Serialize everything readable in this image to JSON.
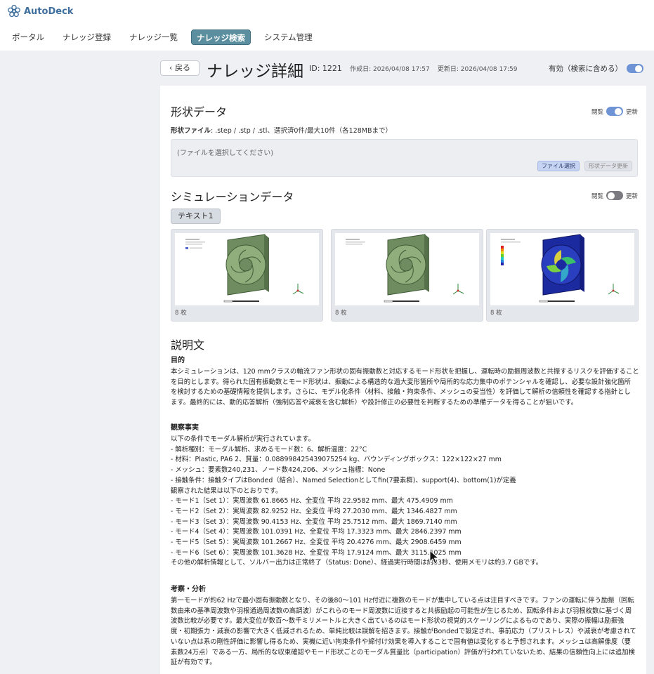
{
  "app": {
    "name": "AutoDeck",
    "logo_icon": "flower-logo-icon",
    "accent": "#3f6f9e"
  },
  "nav": [
    {
      "label": "ポータル",
      "active": false
    },
    {
      "label": "ナレッジ登録",
      "active": false
    },
    {
      "label": "ナレッジ一覧",
      "active": false
    },
    {
      "label": "ナレッジ検索",
      "active": true
    },
    {
      "label": "システム管理",
      "active": false
    }
  ],
  "header": {
    "back_label": "戻る",
    "title": "ナレッジ詳細",
    "id": "ID: 1221",
    "created": "作成日: 2026/04/08 17:57",
    "updated": "更新日: 2026/04/08 17:59",
    "active_label": "有効（検索に含める）",
    "active_on": true
  },
  "shape": {
    "title": "形状データ",
    "view_label": "閲覧",
    "edit_label": "更新",
    "toggle_on": true,
    "hint_label": "形状ファイル",
    "hint_text": ": .step / .stp / .stl、選択済0件/最大10件（各128MBまで）",
    "placeholder": "(ファイルを選択してください)",
    "select_button": "ファイル選択",
    "update_button": "形状データ更新"
  },
  "simulation": {
    "title": "シミュレーションデータ",
    "view_label": "閲覧",
    "edit_label": "更新",
    "toggle_on": false,
    "tab_label": "テキスト1",
    "thumbnails": [
      {
        "count": "8 枚",
        "variant": "total-deformation-green"
      },
      {
        "count": "8 枚",
        "variant": "mode-shape-green"
      },
      {
        "count": "8 枚",
        "variant": "contour-colored"
      }
    ]
  },
  "description": {
    "title": "説明文",
    "purpose": {
      "heading": "目的",
      "lines": [
        "本シミュレーションは、120 mmクラスの軸流ファン形状の固有振動数と対応するモード形状を把握し、運転時の励振周波数と共振するリスクを評価すること",
        "を目的とします。得られた固有振動数とモード形状は、振動による構造的な過大変形箇所や局所的な応力集中のポテンシャルを確認し、必要な設計強化箇所",
        "を検討するための基礎情報を提供します。さらに、モデル化条件（材料、接触・拘束条件、メッシュの妥当性）を評価して解析の信頼性を確認する指針とし",
        "ます。最終的には、動的応答解析（強制応答や減衰を含む解析）や設計修正の必要性を判断するための準備データを得ることが狙いです。"
      ]
    },
    "observation": {
      "heading": "観察事実",
      "lines": [
        "以下の条件でモーダル解析が実行されています。",
        "- 解析種別：モーダル解析、求めるモード数：6、解析温度：22°C",
        "- 材料：Plastic, PA6 2、質量：0.088998425439075254 kg、バウンディングボックス：122×122×27 mm",
        "- メッシュ：要素数240,231、ノード数424,206、メッシュ指標：None",
        "- 接触条件：接触タイプはBonded（結合）、Named Selectionとしてfin(7要素群)、support(4)、bottom(1)が定義",
        "観察された結果は以下のとおりです。",
        "- モード1（Set 1）：実周波数 61.8665 Hz、全変位 平均 22.9582 mm、最大 475.4909 mm",
        "- モード2（Set 2）：実周波数 82.9252 Hz、全変位 平均 27.2030 mm、最大 1346.4827 mm",
        "- モード3（Set 3）：実周波数 90.4153 Hz、全変位 平均 25.7512 mm、最大 1869.7140 mm",
        "- モード4（Set 4）：実周波数 101.0391 Hz、全変位 平均 17.3323 mm、最大 2846.2397 mm",
        "- モード5（Set 5）：実周波数 101.2667 Hz、全変位 平均 20.4276 mm、最大 2908.6459 mm",
        "- モード6（Set 6）：実周波数 101.3628 Hz、全変位 平均 17.9124 mm、最大 3115.5025 mm",
        "その他の解析情報として、ソルバー出力は正常終了（Status: Done）、経過実行時間は約83秒、使用メモリは約3.7 GBです。"
      ]
    },
    "analysis": {
      "heading": "考察・分析",
      "lines": [
        "第一モードが約62 Hzで最小固有振動数となり、その後80〜101 Hz付近に複数のモードが集中している点は注目すべきです。ファンの運転に伴う励振（回転",
        "数由来の基準周波数や羽根通過周波数の高調波）がこれらのモード周波数に近接すると共振励起の可能性が生じるため、回転条件および羽根枚数に基づく周",
        "波数比較が必要です。最大変位が数百〜数千ミリメートルと大きく出ているのはモード形状の視覚的スケーリングによるものであり、実際の振幅は励振強",
        "度・初期張力・減衰の影響で大きく低減されるため、単純比較は誤解を招きます。接触がBondedで設定され、事前応力（プリストレス）や減衰が考慮されて",
        "いない点は系の剛性評価に影響し得るため、実機に近い拘束条件や締付け効果を導入することで固有値は変化すると予想されます。メッシュは高解像度（要",
        "素数24万点）である一方、局所的な収束確認やモード形状ごとのモーダル質量比（participation）評価が行われていないため、結果の信頼性向上には追加検",
        "証が有効です。"
      ]
    }
  }
}
